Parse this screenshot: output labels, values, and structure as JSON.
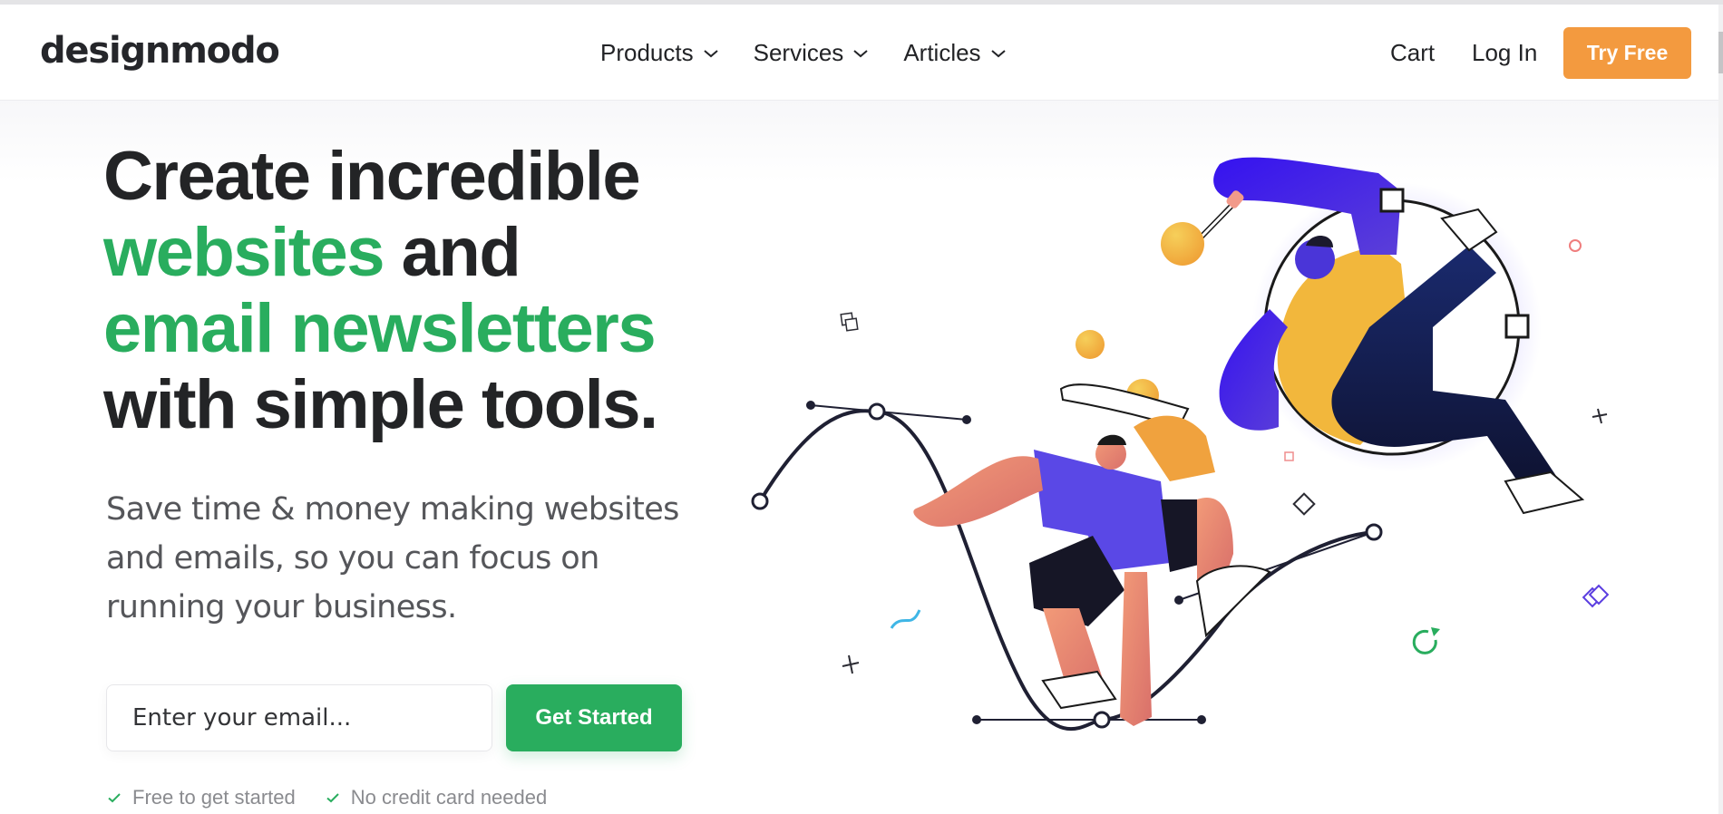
{
  "header": {
    "logo": "designmodo",
    "nav": [
      {
        "label": "Products",
        "icon": "chevron-down-icon"
      },
      {
        "label": "Services",
        "icon": "chevron-down-icon"
      },
      {
        "label": "Articles",
        "icon": "chevron-down-icon"
      }
    ],
    "cart_label": "Cart",
    "login_label": "Log In",
    "cta_label": "Try Free"
  },
  "hero": {
    "headline": {
      "line1": "Create incredible",
      "line2_green": "websites",
      "line2_rest": " and",
      "line3_green": "email newsletters",
      "line4": "with simple tools."
    },
    "subtitle": "Save time & money making websites and emails, so you can focus on running your business.",
    "email_placeholder": "Enter your email...",
    "email_value": "",
    "submit_label": "Get Started",
    "checks": [
      {
        "label": "Free to get started",
        "icon": "check-icon"
      },
      {
        "label": "No credit card needed",
        "icon": "check-icon"
      }
    ]
  },
  "colors": {
    "accent_green": "#29ad5e",
    "accent_orange": "#f39a3f",
    "text_dark": "#232426",
    "illustration_blue": "#3a17e8",
    "illustration_yellow": "#f2b73c"
  }
}
